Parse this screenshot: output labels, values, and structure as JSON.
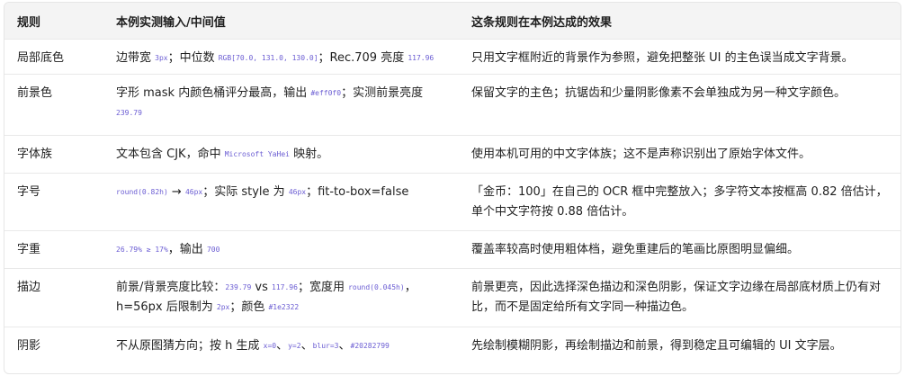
{
  "headers": {
    "col1": "规则",
    "col2": "本例实测输入/中间值",
    "col3": "这条规则在本例达成的效果"
  },
  "rows": [
    {
      "rule": "局部底色",
      "input": [
        {
          "t": "text",
          "v": "边带宽 "
        },
        {
          "t": "code",
          "v": "3px"
        },
        {
          "t": "text",
          "v": "；中位数 "
        },
        {
          "t": "code",
          "v": "RGB[70.0, 131.0, 130.0]"
        },
        {
          "t": "text",
          "v": "；Rec.709 亮度 "
        },
        {
          "t": "code",
          "v": "117.96"
        }
      ],
      "effect": "只用文字框附近的背景作为参照，避免把整张 UI 的主色误当成文字背景。"
    },
    {
      "rule": "前景色",
      "input": [
        {
          "t": "text",
          "v": "字形 mask 内颜色桶评分最高，输出 "
        },
        {
          "t": "code",
          "v": "#eff0f0"
        },
        {
          "t": "text",
          "v": "；实测前景亮度 "
        },
        {
          "t": "code",
          "v": "239.79"
        }
      ],
      "effect": "保留文字的主色；抗锯齿和少量阴影像素不会单独成为另一种文字颜色。"
    },
    {
      "rule": "字体族",
      "input": [
        {
          "t": "text",
          "v": "文本包含 CJK，命中 "
        },
        {
          "t": "code",
          "v": "Microsoft YaHei"
        },
        {
          "t": "text",
          "v": " 映射。"
        }
      ],
      "effect": "使用本机可用的中文字体族；这不是声称识别出了原始字体文件。"
    },
    {
      "rule": "字号",
      "input": [
        {
          "t": "code",
          "v": "round(0.82h)"
        },
        {
          "t": "text",
          "v": " → "
        },
        {
          "t": "code",
          "v": "46px"
        },
        {
          "t": "text",
          "v": "；实际 style 为 "
        },
        {
          "t": "code",
          "v": "46px"
        },
        {
          "t": "text",
          "v": "；fit-to-box=false"
        }
      ],
      "effect": "「金币：100」在自己的 OCR 框中完整放入；多字符文本按框高 0.82 倍估计，单个中文字符按 0.88 倍估计。"
    },
    {
      "rule": "字重",
      "input": [
        {
          "t": "code",
          "v": "26.79% ≥ 17%"
        },
        {
          "t": "text",
          "v": "，输出 "
        },
        {
          "t": "code",
          "v": "700"
        }
      ],
      "effect": "覆盖率较高时使用粗体档，避免重建后的笔画比原图明显偏细。"
    },
    {
      "rule": "描边",
      "input": [
        {
          "t": "text",
          "v": "前景/背景亮度比较："
        },
        {
          "t": "code",
          "v": "239.79"
        },
        {
          "t": "text",
          "v": " vs "
        },
        {
          "t": "code",
          "v": "117.96"
        },
        {
          "t": "text",
          "v": "；宽度用 "
        },
        {
          "t": "code",
          "v": "round(0.045h)"
        },
        {
          "t": "text",
          "v": "，h=56px 后限制为 "
        },
        {
          "t": "code",
          "v": "2px"
        },
        {
          "t": "text",
          "v": "；颜色 "
        },
        {
          "t": "code",
          "v": "#1e2322"
        }
      ],
      "effect": "前景更亮，因此选择深色描边和深色阴影，保证文字边缘在局部底材质上仍有对比，而不是固定给所有文字同一种描边色。"
    },
    {
      "rule": "阴影",
      "input": [
        {
          "t": "text",
          "v": "不从原图猜方向；按 h 生成 "
        },
        {
          "t": "code",
          "v": "x=0"
        },
        {
          "t": "text",
          "v": "、"
        },
        {
          "t": "code",
          "v": "y=2"
        },
        {
          "t": "text",
          "v": "、"
        },
        {
          "t": "code",
          "v": "blur=3"
        },
        {
          "t": "text",
          "v": "、"
        },
        {
          "t": "code",
          "v": "#20282799"
        }
      ],
      "effect": "先绘制模糊阴影，再绘制描边和前景，得到稳定且可编辑的 UI 文字层。"
    }
  ],
  "colors": {
    "code_text": "#6b5dd3",
    "header_bg": "#f4f4f4",
    "border": "#e9e9e9"
  }
}
